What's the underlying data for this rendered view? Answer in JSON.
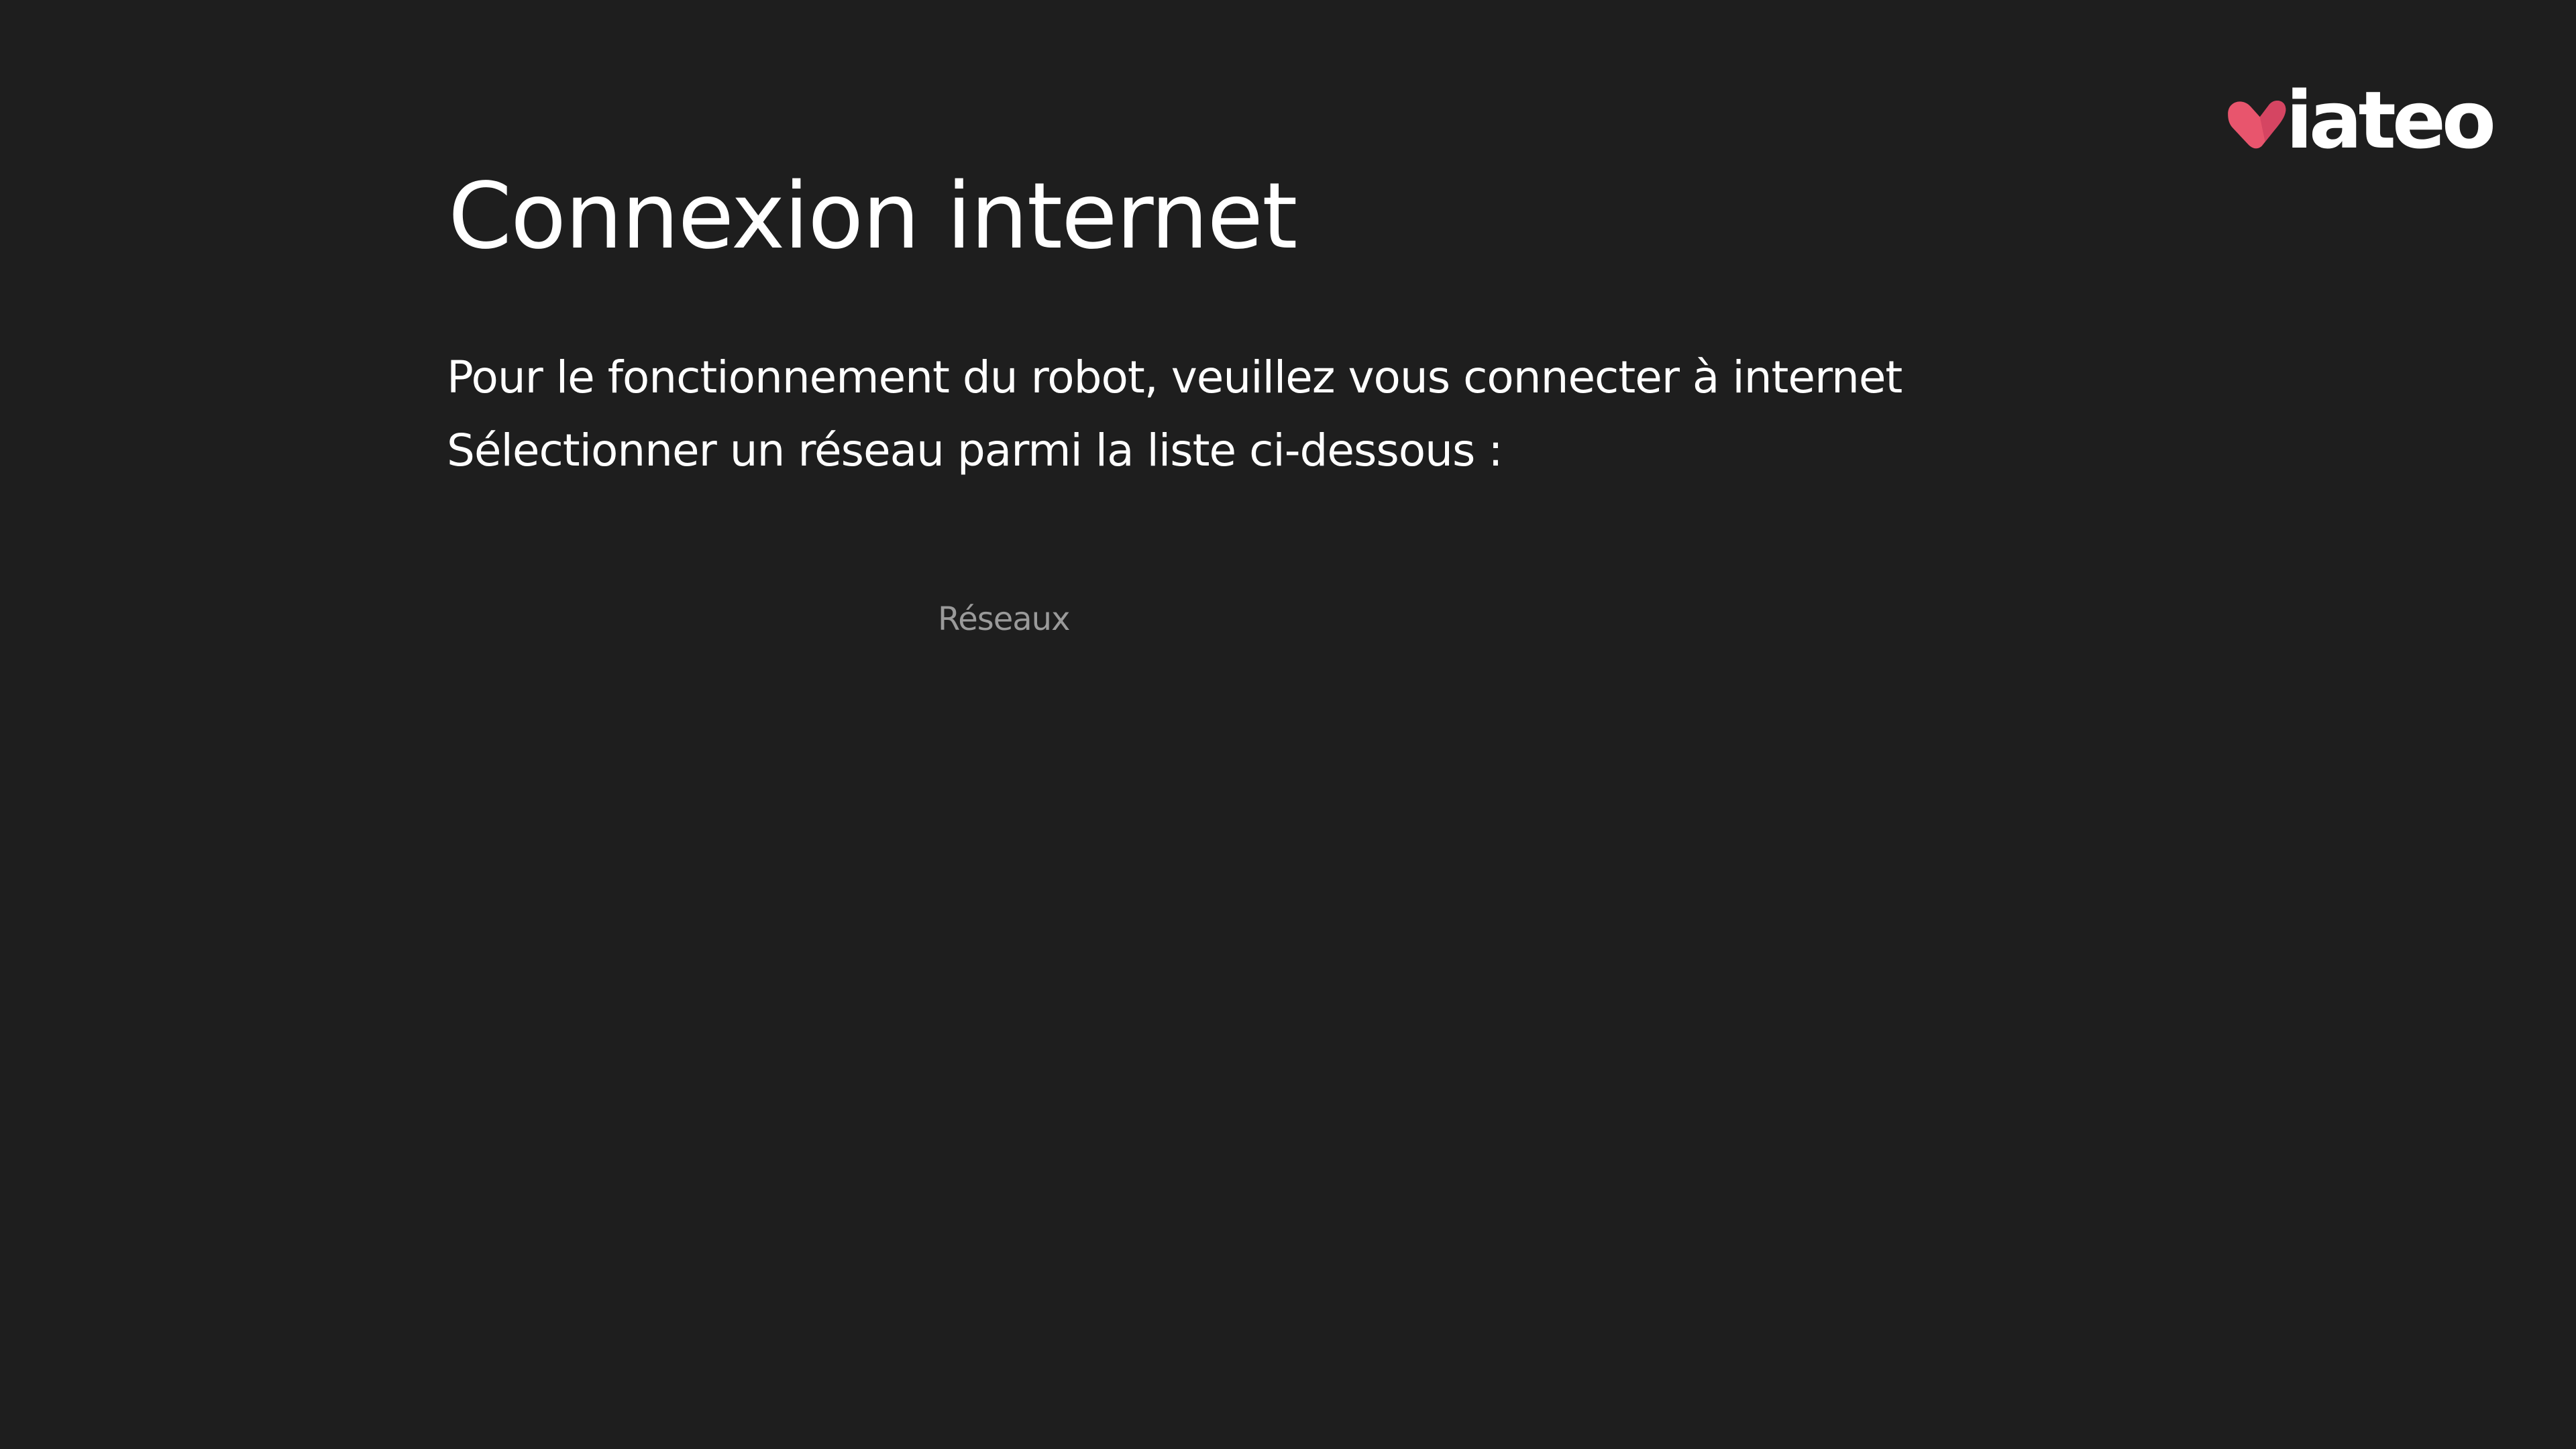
{
  "brand": {
    "name": "iateo",
    "mark_color": "#e8556d"
  },
  "page": {
    "title": "Connexion internet",
    "description_line1": "Pour le fonctionnement du robot, veuillez vous connecter à internet",
    "description_line2": "Sélectionner un réseau parmi la liste ci-dessous :"
  },
  "networks": {
    "label": "Réseaux",
    "items": []
  },
  "colors": {
    "background": "#1e1e1e",
    "text": "#ffffff",
    "muted_text": "#9a9a9a",
    "accent": "#e8556d"
  }
}
